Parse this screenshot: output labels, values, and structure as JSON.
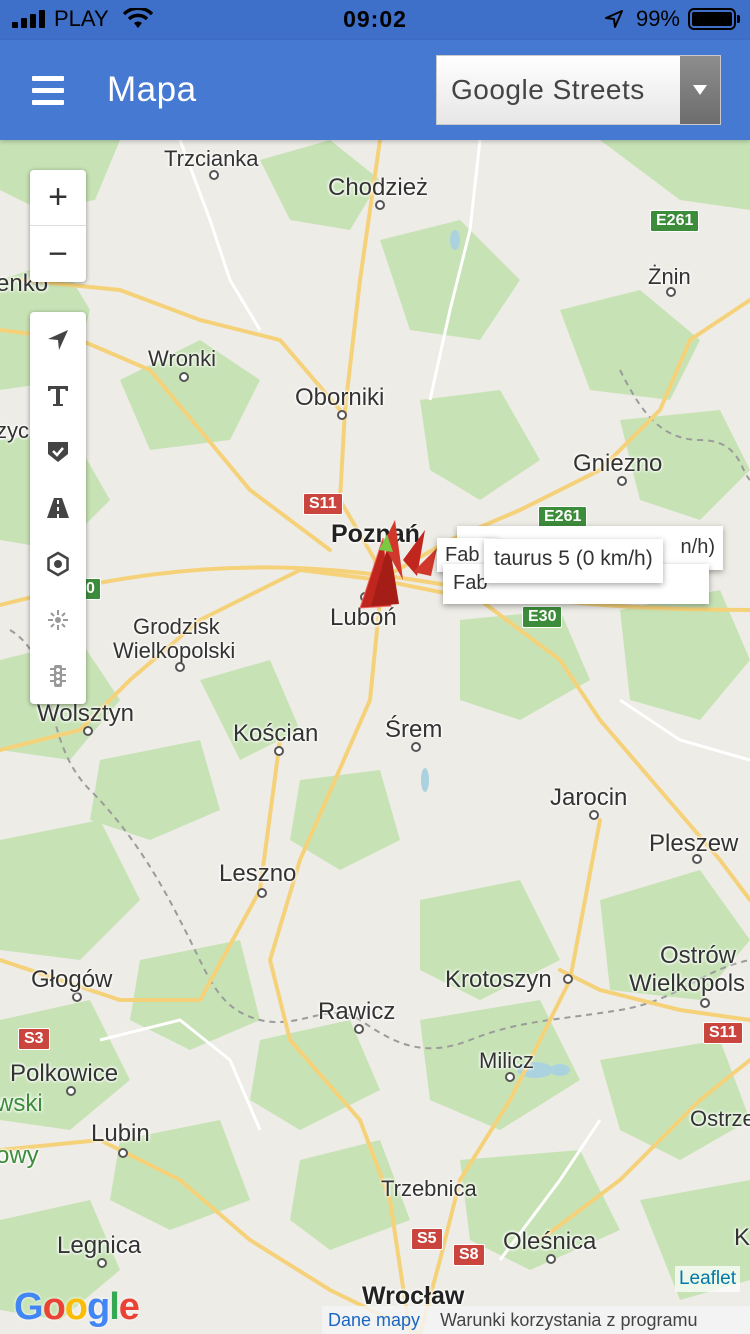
{
  "status_bar": {
    "carrier": "PLAY",
    "time": "09:02",
    "battery": "99%"
  },
  "app_bar": {
    "title": "Mapa",
    "layer_select": {
      "value": "Google Streets"
    }
  },
  "map": {
    "controls": {
      "zoom_in": "+",
      "zoom_out": "−",
      "tools": [
        "navigate-icon",
        "text-icon",
        "shield-check-icon",
        "road-icon",
        "settings-icon",
        "poi-icon",
        "traffic-light-icon"
      ]
    },
    "places": [
      {
        "name": "Trzcianka"
      },
      {
        "name": "Chodzież"
      },
      {
        "name": "enko"
      },
      {
        "name": "Żnin"
      },
      {
        "name": "Wronki"
      },
      {
        "name": "Oborniki"
      },
      {
        "name": "zyc"
      },
      {
        "name": "Gniezno"
      },
      {
        "name": "Poznań"
      },
      {
        "name": "Luboń"
      },
      {
        "name": "Grodzisk"
      },
      {
        "name": "Wielkopolski"
      },
      {
        "name": "Wolsztyn"
      },
      {
        "name": "Kościan"
      },
      {
        "name": "Śrem"
      },
      {
        "name": "Jarocin"
      },
      {
        "name": "Pleszew"
      },
      {
        "name": "Leszno"
      },
      {
        "name": "Ostrów"
      },
      {
        "name": "Wielkopols"
      },
      {
        "name": "Głogów"
      },
      {
        "name": "Krotoszyn"
      },
      {
        "name": "Rawicz"
      },
      {
        "name": "Polkowice"
      },
      {
        "name": "wski"
      },
      {
        "name": "Milicz"
      },
      {
        "name": "Lubin"
      },
      {
        "name": "Ostrze"
      },
      {
        "name": "owy"
      },
      {
        "name": "Trzebnica"
      },
      {
        "name": "Legnica"
      },
      {
        "name": "Oleśnica"
      },
      {
        "name": "Wrocław"
      },
      {
        "name": "K"
      }
    ],
    "road_shields": [
      "E261",
      "S11",
      "E261",
      "E30",
      "S3",
      "S11",
      "S5",
      "S8",
      "0"
    ],
    "popups": {
      "main": "taurus 5 (0 km/h)",
      "behind_1": "Fab",
      "behind_2": "n/h)",
      "behind_3": "Fab"
    },
    "attribution": {
      "leaflet": "Leaflet",
      "map_data": "Dane mapy",
      "terms": "Warunki korzystania z programu",
      "google": "Google"
    }
  },
  "colors": {
    "status_bar": "#3e6fc9",
    "app_bar": "#4679d1",
    "marker_red": "#c0261d",
    "marker_green": "#7ac943"
  }
}
